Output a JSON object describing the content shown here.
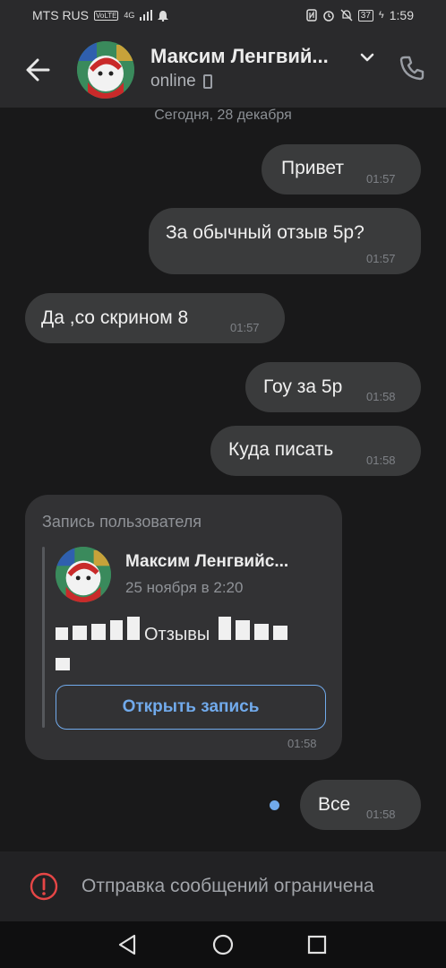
{
  "status_bar": {
    "carrier": "MTS RUS",
    "volte": "VoLTE",
    "network": "4G",
    "battery": "37",
    "time": "1:59"
  },
  "header": {
    "name": "Максим Ленгвий...",
    "status": "online",
    "icons": [
      "back-arrow-icon",
      "chevron-down-icon",
      "phone-icon",
      "mobile-device-icon"
    ]
  },
  "date_separator": "Сегодня, 28 декабря",
  "messages": [
    {
      "text": "Привет",
      "time": "01:57",
      "side": "out"
    },
    {
      "text": "За обычный отзыв 5р?",
      "time": "01:57",
      "side": "out"
    },
    {
      "text": "Да ,со скрином 8",
      "time": "01:57",
      "side": "in"
    },
    {
      "text": "Гоу за 5р",
      "time": "01:58",
      "side": "out"
    },
    {
      "text": "Куда писать",
      "time": "01:58",
      "side": "out"
    },
    {
      "text": "Все",
      "time": "01:58",
      "side": "out"
    }
  ],
  "repost": {
    "title": "Запись пользователя",
    "author": "Максим Ленгвийс...",
    "date": "25 ноября в 2:20",
    "text": "Отзывы",
    "button": "Открыть запись",
    "time": "01:58"
  },
  "restriction": {
    "text": "Отправка сообщений ограничена",
    "icon": "warning-icon"
  },
  "colors": {
    "background": "#19191a",
    "header": "#2a2a2c",
    "bubble": "#3a3b3c",
    "accent": "#71aaeb",
    "warning": "#e64646"
  }
}
